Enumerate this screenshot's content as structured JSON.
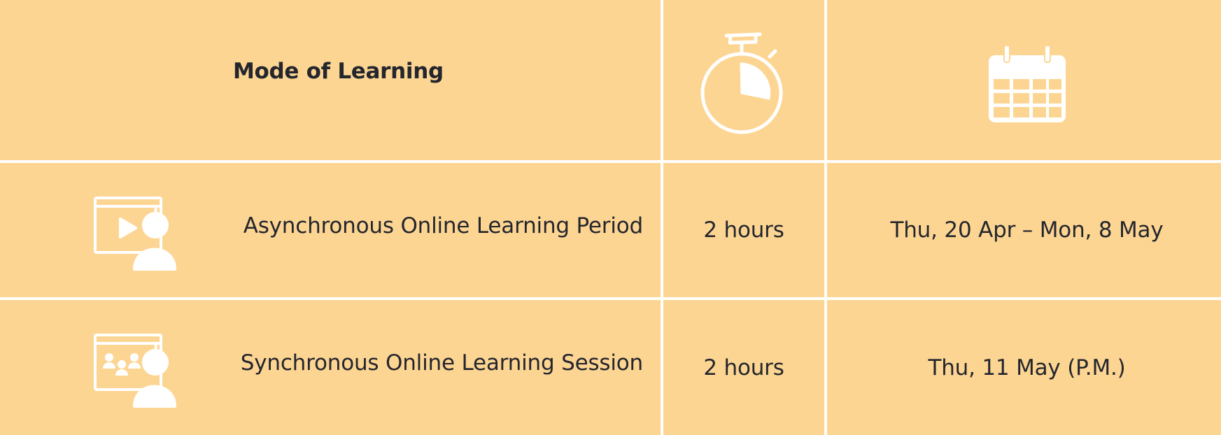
{
  "header": {
    "mode_title": "Mode of Learning",
    "duration_icon": "stopwatch-icon",
    "date_icon": "calendar-icon"
  },
  "rows": [
    {
      "icon": "video-presenter-icon",
      "mode": "Asynchronous Online Learning Period",
      "duration": "2 hours",
      "dates": "Thu, 20 Apr – Mon, 8 May"
    },
    {
      "icon": "group-presenter-icon",
      "mode": "Synchronous Online Learning Session",
      "duration": "2 hours",
      "dates": "Thu, 11 May (P.M.)"
    }
  ],
  "colors": {
    "cell_background": "#FDD593",
    "grid_lines": "#FFFFFF",
    "text": "#24262D",
    "icon": "#FFFFFF"
  }
}
